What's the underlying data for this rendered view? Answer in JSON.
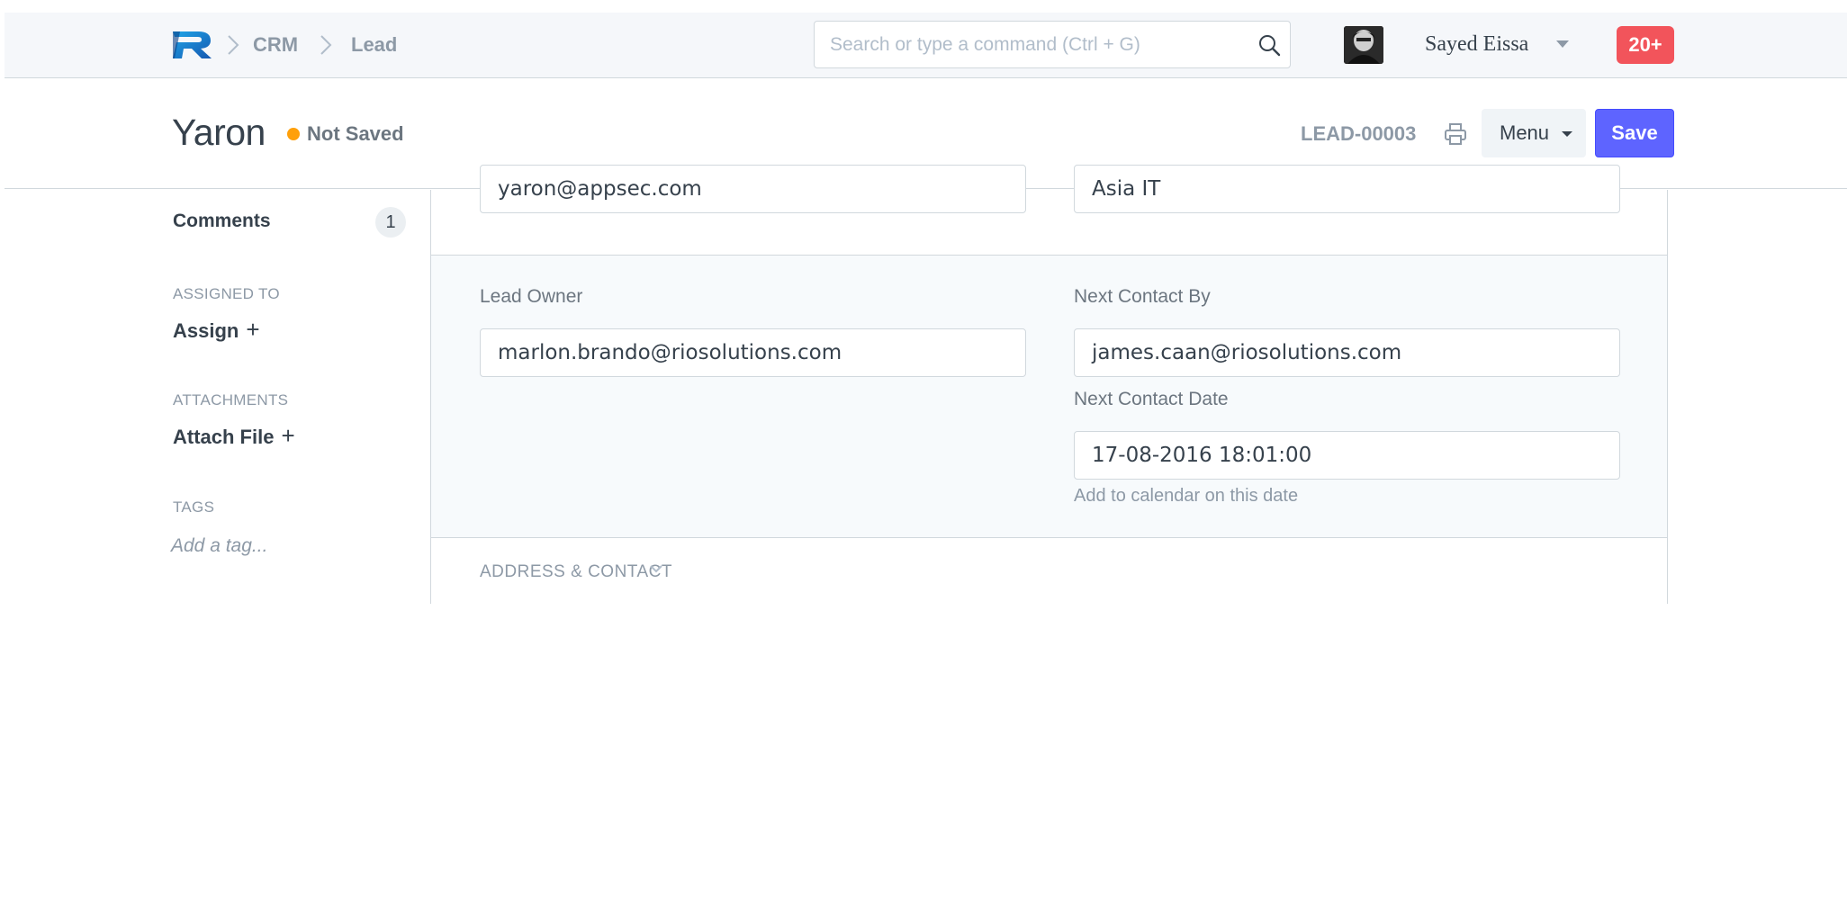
{
  "navbar": {
    "breadcrumbs": [
      "CRM",
      "Lead"
    ],
    "search_placeholder": "Search or type a command (Ctrl + G)",
    "user_name": "Sayed Eissa",
    "notifications": "20+"
  },
  "page_head": {
    "title": "Yaron",
    "status": "Not Saved",
    "status_color": "#ffa00a",
    "doc_name": "LEAD-00003",
    "menu_label": "Menu",
    "save_label": "Save",
    "save_color": "#5e64ff"
  },
  "sidebar": {
    "comments_label": "Comments",
    "comments_count": "1",
    "assigned_heading": "ASSIGNED TO",
    "assign_label": "Assign",
    "attachments_heading": "ATTACHMENTS",
    "attach_label": "Attach File",
    "tags_heading": "TAGS",
    "tag_placeholder": "Add a tag..."
  },
  "form": {
    "email_value": "yaron@appsec.com",
    "company_value": "Asia IT",
    "lead_owner": {
      "label": "Lead Owner",
      "value": "marlon.brando@riosolutions.com"
    },
    "next_contact_by": {
      "label": "Next Contact By",
      "value": "james.caan@riosolutions.com"
    },
    "next_contact_date": {
      "label": "Next Contact Date",
      "value": "17-08-2016 18:01:00",
      "help": "Add to calendar on this date"
    },
    "address_section": "ADDRESS & CONTACT"
  }
}
